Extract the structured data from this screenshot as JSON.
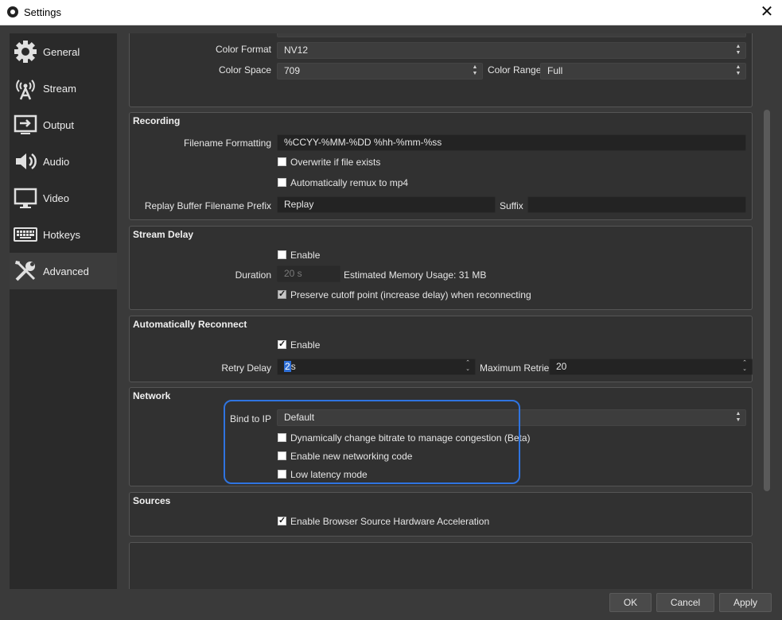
{
  "window": {
    "title": "Settings",
    "close_glyph": "✕"
  },
  "sidebar": {
    "items": [
      {
        "label": "General",
        "icon": "gear-icon"
      },
      {
        "label": "Stream",
        "icon": "antenna-icon"
      },
      {
        "label": "Output",
        "icon": "output-icon"
      },
      {
        "label": "Audio",
        "icon": "speaker-icon"
      },
      {
        "label": "Video",
        "icon": "monitor-icon"
      },
      {
        "label": "Hotkeys",
        "icon": "keyboard-icon"
      },
      {
        "label": "Advanced",
        "icon": "tools-icon",
        "active": true
      }
    ]
  },
  "video_group": {
    "color_format_label": "Color Format",
    "color_format_value": "NV12",
    "color_space_label": "Color Space",
    "color_space_value": "709",
    "color_range_label": "Color Range",
    "color_range_value": "Full"
  },
  "recording": {
    "title": "Recording",
    "filename_formatting_label": "Filename Formatting",
    "filename_formatting_value": "%CCYY-%MM-%DD %hh-%mm-%ss",
    "overwrite_label": "Overwrite if file exists",
    "remux_label": "Automatically remux to mp4",
    "replay_prefix_label": "Replay Buffer Filename Prefix",
    "replay_prefix_value": "Replay",
    "suffix_label": "Suffix",
    "suffix_value": ""
  },
  "stream_delay": {
    "title": "Stream Delay",
    "enable_label": "Enable",
    "duration_label": "Duration",
    "duration_value": "20 s",
    "memory_usage": "Estimated Memory Usage: 31 MB",
    "preserve_label": "Preserve cutoff point (increase delay) when reconnecting"
  },
  "reconnect": {
    "title": "Automatically Reconnect",
    "enable_label": "Enable",
    "retry_delay_label": "Retry Delay",
    "retry_delay_selected": "2",
    "retry_delay_unit": "s",
    "max_retries_label": "Maximum Retries",
    "max_retries_value": "20"
  },
  "network": {
    "title": "Network",
    "bind_ip_label": "Bind to IP",
    "bind_ip_value": "Default",
    "dynamic_bitrate_label": "Dynamically change bitrate to manage congestion (Beta)",
    "new_networking_label": "Enable new networking code",
    "low_latency_label": "Low latency mode"
  },
  "sources": {
    "title": "Sources",
    "browser_accel_label": "Enable Browser Source Hardware Acceleration"
  },
  "buttons": {
    "ok": "OK",
    "cancel": "Cancel",
    "apply": "Apply"
  },
  "colors": {
    "highlight": "#2f74e0",
    "background": "#3a3a3a",
    "sidebar": "#2a2a2a"
  }
}
